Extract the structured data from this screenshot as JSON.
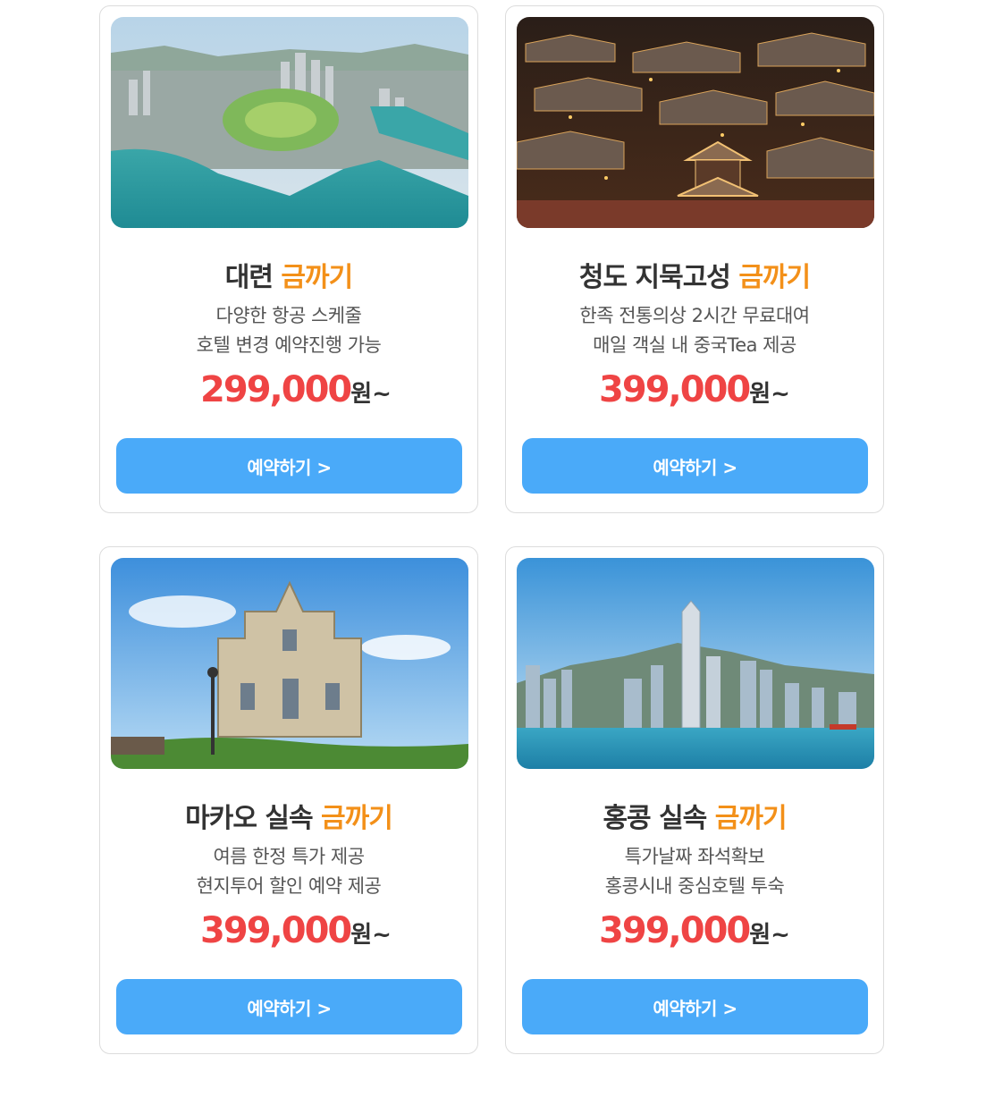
{
  "cards": [
    {
      "title_main": "대련",
      "title_highlight": "금까기",
      "desc_line1": "다양한 항공 스케줄",
      "desc_line2": "호텔 변경 예약진행 가능",
      "price": "299,000",
      "price_unit": "원~",
      "button_label": "예약하기 >",
      "image": "dalian-aerial-city-photo"
    },
    {
      "title_main": "청도 지묵고성",
      "title_highlight": "금까기",
      "desc_line1": "한족 전통의상 2시간 무료대여",
      "desc_line2": "매일 객실 내 중국Tea 제공",
      "price": "399,000",
      "price_unit": "원~",
      "button_label": "예약하기 >",
      "image": "qingdao-ancient-town-night-photo"
    },
    {
      "title_main": "마카오 실속",
      "title_highlight": "금까기",
      "desc_line1": "여름 한정 특가 제공",
      "desc_line2": "현지투어 할인 예약 제공",
      "price": "399,000",
      "price_unit": "원~",
      "button_label": "예약하기 >",
      "image": "macau-st-pauls-ruins-photo"
    },
    {
      "title_main": "홍콩 실속",
      "title_highlight": "금까기",
      "desc_line1": "특가날짜 좌석확보",
      "desc_line2": "홍콩시내 중심호텔 투숙",
      "price": "399,000",
      "price_unit": "원~",
      "button_label": "예약하기 >",
      "image": "hong-kong-skyline-photo"
    }
  ],
  "colors": {
    "highlight": "#f39019",
    "price": "#ef4444",
    "button": "#4aaaf9",
    "title": "#333333"
  }
}
